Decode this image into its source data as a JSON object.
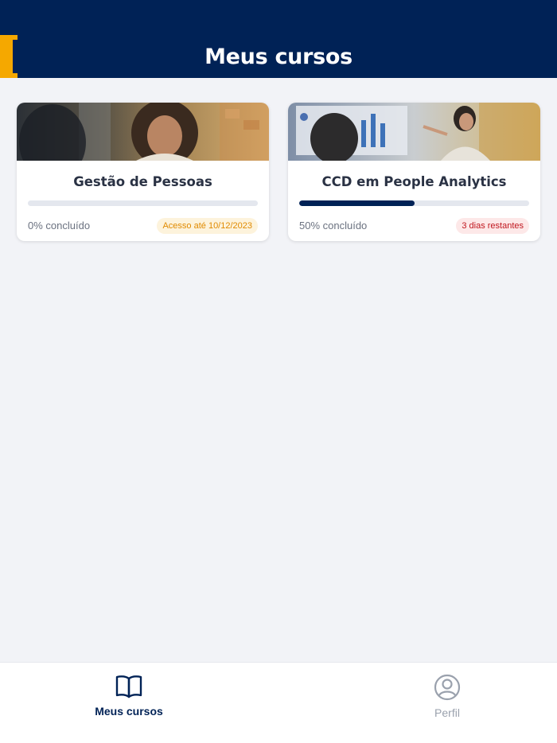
{
  "header": {
    "title": "Meus cursos"
  },
  "colors": {
    "navy": "#002256",
    "accent": "#f5a800"
  },
  "courses": [
    {
      "title": "Gestão de Pessoas",
      "progress": 0,
      "progress_text": "0% concluído",
      "badge": "Acesso até 10/12/2023",
      "badge_type": "warning"
    },
    {
      "title": "CCD em People Analytics",
      "progress": 50,
      "progress_text": "50% concluído",
      "badge": "3 dias restantes",
      "badge_type": "danger"
    }
  ],
  "bottom_nav": [
    {
      "label": "Meus cursos",
      "icon": "book-icon",
      "active": true
    },
    {
      "label": "Perfil",
      "icon": "profile-icon",
      "active": false
    }
  ]
}
